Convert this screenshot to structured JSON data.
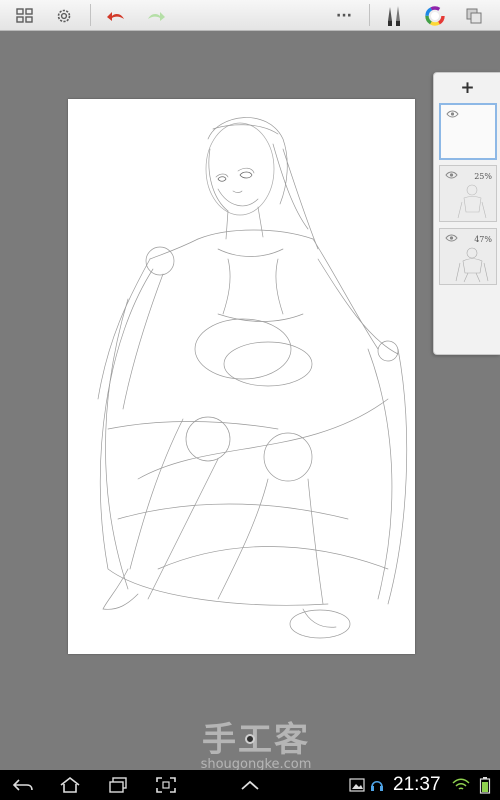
{
  "toolbar": {
    "left_icons": [
      "grid-icon",
      "gear-icon",
      "undo-icon",
      "redo-icon"
    ],
    "right_icons": [
      "more-icon",
      "brush-icon",
      "color-wheel-icon",
      "layers-copy-icon"
    ],
    "more_label": "···"
  },
  "layers": {
    "add_label": "+",
    "items": [
      {
        "opacity": "",
        "active": true
      },
      {
        "opacity": "25%",
        "active": false
      },
      {
        "opacity": "47%",
        "active": false
      }
    ]
  },
  "watermark": {
    "title": "手工客",
    "subtitle": "shougongke.com"
  },
  "status_bar": {
    "time": "21:37"
  },
  "colors": {
    "undo": "#d23a2a",
    "redo": "#b5dfa7",
    "toolbar": "#ececec",
    "background": "#7b7b7b"
  }
}
